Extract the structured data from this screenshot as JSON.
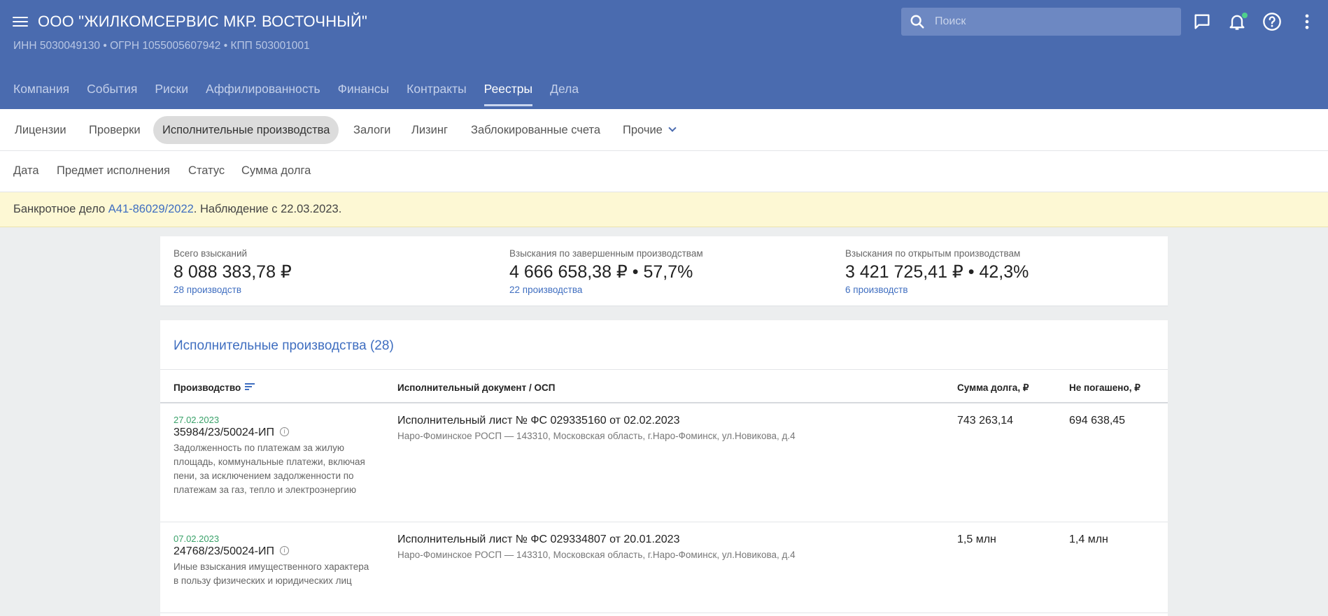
{
  "header": {
    "company_name": "ООО \"ЖИЛКОМСЕРВИС МКР. ВОСТОЧНЫЙ\"",
    "company_ids": "ИНН 5030049130  •  ОГРН 1055005607942  •  КПП 503001001",
    "search_placeholder": "Поиск",
    "icons": [
      "menu-icon",
      "search-icon",
      "chat-icon",
      "bell-icon",
      "help-icon",
      "more-vertical-icon"
    ],
    "colors": {
      "bar": "#4a6baf",
      "notification_dot": "#4fd18b"
    }
  },
  "main_tabs": [
    {
      "label": "Компания",
      "active": false
    },
    {
      "label": "События",
      "active": false
    },
    {
      "label": "Риски",
      "active": false
    },
    {
      "label": "Аффилированность",
      "active": false
    },
    {
      "label": "Финансы",
      "active": false
    },
    {
      "label": "Контракты",
      "active": false
    },
    {
      "label": "Реестры",
      "active": true
    },
    {
      "label": "Дела",
      "active": false
    }
  ],
  "sub_tabs": [
    {
      "label": "Лицензии",
      "active": false
    },
    {
      "label": "Проверки",
      "active": false
    },
    {
      "label": "Исполнительные производства",
      "active": true
    },
    {
      "label": "Залоги",
      "active": false
    },
    {
      "label": "Лизинг",
      "active": false
    },
    {
      "label": "Заблокированные счета",
      "active": false
    },
    {
      "label": "Прочие",
      "active": false,
      "dropdown": true
    }
  ],
  "filters": [
    "Дата",
    "Предмет исполнения",
    "Статус",
    "Сумма долга"
  ],
  "banner": {
    "prefix": "Банкротное дело ",
    "case_link": "А41-86029/2022",
    "suffix": ". Наблюдение с 22.03.2023."
  },
  "summary": [
    {
      "label": "Всего взысканий",
      "value": "8 088 383,78 ₽",
      "link": "28 производств"
    },
    {
      "label": "Взыскания по завершенным производствам",
      "value": "4 666 658,38 ₽ • 57,7%",
      "link": "22 производства"
    },
    {
      "label": "Взыскания по открытым производствам",
      "value": "3 421 725,41 ₽ • 42,3%",
      "link": "6 производств"
    }
  ],
  "table": {
    "title": "Исполнительные производства (28)",
    "columns": [
      "Производство",
      "Исполнительный документ / ОСП",
      "Сумма долга, ₽",
      "Не погашено, ₽"
    ],
    "rows": [
      {
        "date": "27.02.2023",
        "number": "35984/23/50024-ИП",
        "description": "Задолженность по платежам за жилую площадь, коммунальные платежи, включая пени, за исключением задолженности по платежам за газ, тепло и электроэнергию",
        "document": "Исполнительный лист № ФС 029335160 от 02.02.2023",
        "osp": "Наро-Фоминское РОСП — 143310, Московская область, г.Наро-Фоминск, ул.Новикова, д.4",
        "debt": "743 263,14",
        "unpaid": "694 638,45"
      },
      {
        "date": "07.02.2023",
        "number": "24768/23/50024-ИП",
        "description": "Иные взыскания имущественного характера в пользу физических и юридических лиц",
        "document": "Исполнительный лист № ФС 029334807 от 20.01.2023",
        "osp": "Наро-Фоминское РОСП — 143310, Московская область, г.Наро-Фоминск, ул.Новикова, д.4",
        "debt": "1,5 млн",
        "unpaid": "1,4 млн"
      }
    ]
  }
}
